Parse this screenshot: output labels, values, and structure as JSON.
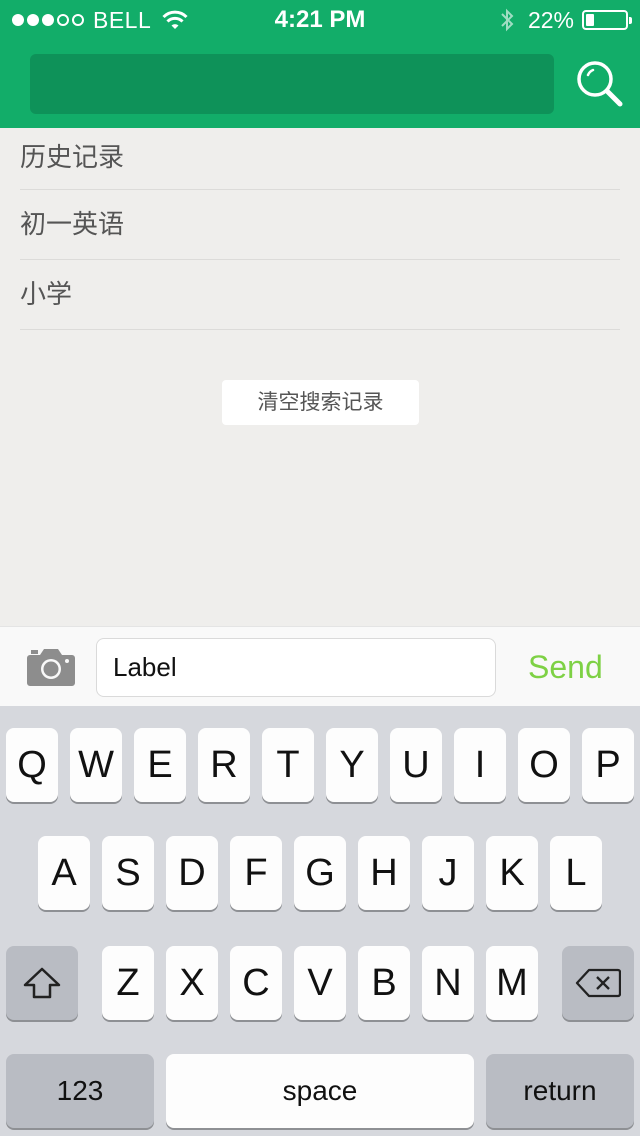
{
  "status_bar": {
    "carrier": "BELL",
    "time": "4:21 PM",
    "battery_percent": "22%",
    "battery_level": 0.22,
    "signal_bars_filled": 3,
    "signal_bars_total": 5
  },
  "header": {
    "search_placeholder": "",
    "search_icon": "search-icon",
    "accent_color": "#12ad69"
  },
  "history": {
    "title": "历史记录",
    "items": [
      "初一英语",
      "小学"
    ],
    "clear_label": "清空搜索记录"
  },
  "input_bar": {
    "camera_icon": "camera-icon",
    "field_value": "Label",
    "send_label": "Send",
    "send_color": "#7ed145"
  },
  "keyboard": {
    "row1": [
      "Q",
      "W",
      "E",
      "R",
      "T",
      "Y",
      "U",
      "I",
      "O",
      "P"
    ],
    "row2": [
      "A",
      "S",
      "D",
      "F",
      "G",
      "H",
      "J",
      "K",
      "L"
    ],
    "row3": [
      "Z",
      "X",
      "C",
      "V",
      "B",
      "N",
      "M"
    ],
    "numbers_label": "123",
    "space_label": "space",
    "return_label": "return",
    "shift_icon": "shift-icon",
    "delete_icon": "delete-icon"
  }
}
